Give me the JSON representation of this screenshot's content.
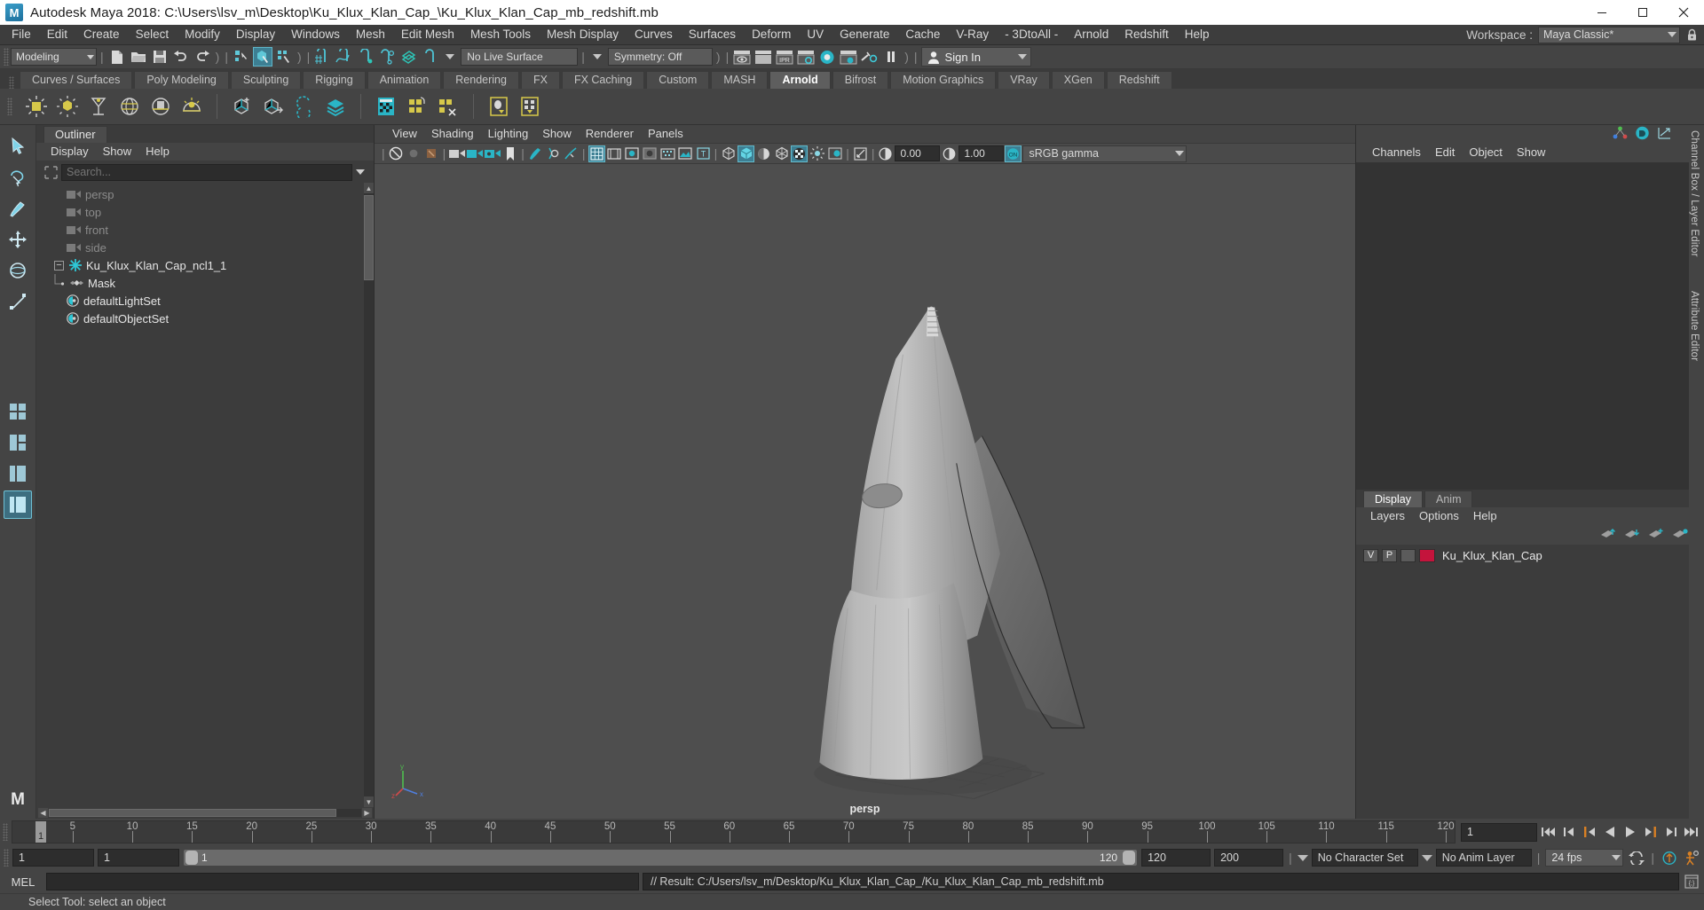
{
  "titlebar": {
    "app_title": "Autodesk Maya 2018: C:\\Users\\lsv_m\\Desktop\\Ku_Klux_Klan_Cap_\\Ku_Klux_Klan_Cap_mb_redshift.mb",
    "logo_text": "M",
    "minimize": "minimize-icon",
    "maximize": "maximize-icon",
    "close": "close-icon"
  },
  "menubar": {
    "items": [
      {
        "label": "File"
      },
      {
        "label": "Edit"
      },
      {
        "label": "Create"
      },
      {
        "label": "Select"
      },
      {
        "label": "Modify"
      },
      {
        "label": "Display"
      },
      {
        "label": "Windows"
      },
      {
        "label": "Mesh"
      },
      {
        "label": "Edit Mesh"
      },
      {
        "label": "Mesh Tools"
      },
      {
        "label": "Mesh Display"
      },
      {
        "label": "Curves"
      },
      {
        "label": "Surfaces"
      },
      {
        "label": "Deform"
      },
      {
        "label": "UV"
      },
      {
        "label": "Generate"
      },
      {
        "label": "Cache"
      },
      {
        "label": "V-Ray"
      },
      {
        "label": "- 3DtoAll -"
      },
      {
        "label": "Arnold"
      },
      {
        "label": "Redshift"
      },
      {
        "label": "Help"
      }
    ],
    "workspace_label": "Workspace :",
    "workspace_value": "Maya Classic*"
  },
  "statusline": {
    "menuset_value": "Modeling",
    "live_surface_value": "No Live Surface",
    "symmetry_value": "Symmetry: Off",
    "signin_label": "Sign In"
  },
  "shelf": {
    "tabs": [
      {
        "label": "Curves / Surfaces"
      },
      {
        "label": "Poly Modeling"
      },
      {
        "label": "Sculpting"
      },
      {
        "label": "Rigging"
      },
      {
        "label": "Animation"
      },
      {
        "label": "Rendering"
      },
      {
        "label": "FX"
      },
      {
        "label": "FX Caching"
      },
      {
        "label": "Custom"
      },
      {
        "label": "MASH"
      },
      {
        "label": "Arnold"
      },
      {
        "label": "Bifrost"
      },
      {
        "label": "Motion Graphics"
      },
      {
        "label": "VRay"
      },
      {
        "label": "XGen"
      },
      {
        "label": "Redshift"
      }
    ],
    "active_tab": "Arnold"
  },
  "outliner": {
    "tab_label": "Outliner",
    "menus": [
      {
        "label": "Display"
      },
      {
        "label": "Show"
      },
      {
        "label": "Help"
      }
    ],
    "search_placeholder": "Search...",
    "search_value": "",
    "items": [
      {
        "label": "persp",
        "icon": "camera-icon",
        "indent": 1,
        "dim": true,
        "expandable": false
      },
      {
        "label": "top",
        "icon": "camera-icon",
        "indent": 1,
        "dim": true,
        "expandable": false
      },
      {
        "label": "front",
        "icon": "camera-icon",
        "indent": 1,
        "dim": true,
        "expandable": false
      },
      {
        "label": "side",
        "icon": "camera-icon",
        "indent": 1,
        "dim": true,
        "expandable": false
      },
      {
        "label": "Ku_Klux_Klan_Cap_ncl1_1",
        "icon": "nucleus-icon",
        "indent": 0,
        "dim": false,
        "expandable": true
      },
      {
        "label": "Mask",
        "icon": "mesh-icon",
        "indent": 2,
        "dim": false,
        "expandable": false
      },
      {
        "label": "defaultLightSet",
        "icon": "set-icon",
        "indent": 1,
        "dim": false,
        "expandable": false
      },
      {
        "label": "defaultObjectSet",
        "icon": "set-icon",
        "indent": 1,
        "dim": false,
        "expandable": false
      }
    ]
  },
  "viewport": {
    "menus": [
      {
        "label": "View"
      },
      {
        "label": "Shading"
      },
      {
        "label": "Lighting"
      },
      {
        "label": "Show"
      },
      {
        "label": "Renderer"
      },
      {
        "label": "Panels"
      }
    ],
    "exposure_value": "0.00",
    "gamma_value": "1.00",
    "color_profile": "sRGB gamma",
    "camera_label": "persp",
    "axis_x": "x",
    "axis_y": "y",
    "axis_z": "z"
  },
  "channelbox": {
    "menus": [
      {
        "label": "Channels"
      },
      {
        "label": "Edit"
      },
      {
        "label": "Object"
      },
      {
        "label": "Show"
      }
    ],
    "sidebar_labels": [
      "Channel Box / Layer Editor",
      "Attribute Editor"
    ]
  },
  "layers": {
    "tabs": [
      {
        "label": "Display"
      },
      {
        "label": "Anim"
      }
    ],
    "active_tab": "Display",
    "menus": [
      {
        "label": "Layers"
      },
      {
        "label": "Options"
      },
      {
        "label": "Help"
      }
    ],
    "rows": [
      {
        "visible": "V",
        "playback": "P",
        "shade": "",
        "color": "#c4143c",
        "name": "Ku_Klux_Klan_Cap"
      }
    ]
  },
  "timeslider": {
    "ticks": [
      5,
      10,
      15,
      20,
      25,
      30,
      35,
      40,
      45,
      50,
      55,
      60,
      65,
      70,
      75,
      80,
      85,
      90,
      95,
      100,
      105,
      110,
      115,
      120
    ],
    "range_start": 1,
    "range_end": 120,
    "current_frame": "1",
    "current_frame_box": "1",
    "playback_buttons": [
      "go-to-start-icon",
      "step-back-keyframe-icon",
      "step-back-frame-icon",
      "play-backwards-icon",
      "play-forwards-icon",
      "step-forward-frame-icon",
      "step-forward-keyframe-icon",
      "go-to-end-icon"
    ]
  },
  "rangeslider": {
    "anim_start": "1",
    "range_start": "1",
    "bar_start_label": "1",
    "bar_end_label": "120",
    "range_end": "120",
    "anim_end": "200",
    "character_set": "No Character Set",
    "anim_layer": "No Anim Layer",
    "fps": "24 fps",
    "loop_icon": "loop-icon",
    "key_icon": "auto-keyframe-icon",
    "prefs_icon": "animation-preferences-icon"
  },
  "commandline": {
    "mel_label": "MEL",
    "input_value": "",
    "output_text": "// Result: C:/Users/lsv_m/Desktop/Ku_Klux_Klan_Cap_/Ku_Klux_Klan_Cap_mb_redshift.mb",
    "script_editor_icon": "script-editor-icon"
  },
  "helpline": {
    "text": "Select Tool: select an object"
  },
  "toolbox": {
    "tools": [
      {
        "name": "select-tool",
        "selected": false
      },
      {
        "name": "lasso-tool",
        "selected": false
      },
      {
        "name": "paint-select-tool",
        "selected": false
      },
      {
        "name": "move-tool",
        "selected": false
      },
      {
        "name": "rotate-tool",
        "selected": false
      },
      {
        "name": "scale-tool",
        "selected": false
      },
      {
        "name": "last-tool",
        "selected": false
      },
      {
        "name": "layout-four-view",
        "selected": false
      },
      {
        "name": "layout-two-pane",
        "selected": false
      },
      {
        "name": "layout-single-pane",
        "selected": true
      }
    ],
    "logo": "M"
  },
  "colors": {
    "accent": "#3d7f93",
    "accent_light": "#62b9cb",
    "panel_bg": "#444444",
    "dark_bg": "#2d2d2d",
    "layer_color": "#c4143c",
    "playhead": "#d98024"
  }
}
